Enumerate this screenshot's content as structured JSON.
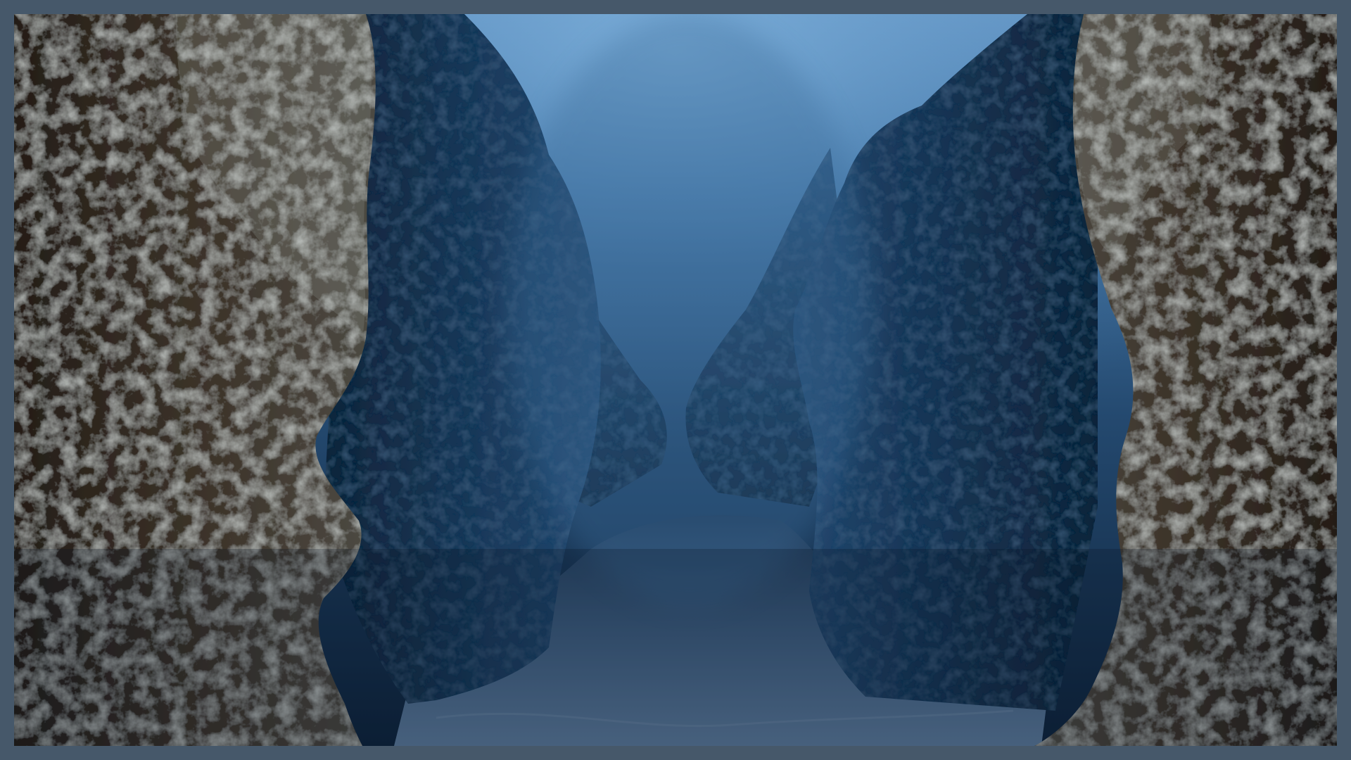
{
  "scene": {
    "description_label": "",
    "subject": "underwater-canyon",
    "colors": {
      "frame": "#46586a",
      "water_top": "#5f8fbd",
      "water_mid": "#2f5b86",
      "water_deep": "#112842",
      "rock_near": "#3a3128",
      "rock_near_light": "#7b8582",
      "rock_far": "#16324f",
      "sand": "#3f5f82",
      "sand_light": "#6f8aa7"
    }
  }
}
